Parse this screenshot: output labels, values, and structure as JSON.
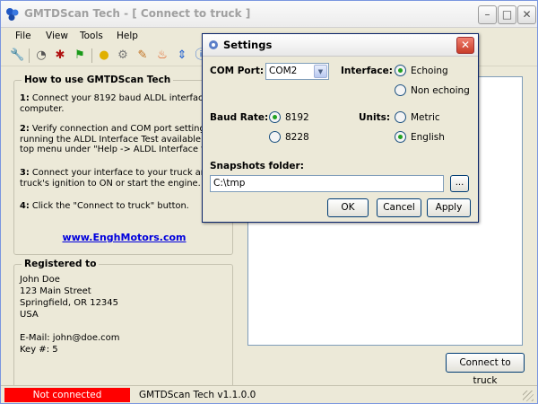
{
  "window": {
    "title": "GMTDScan Tech - [ Connect to truck ]",
    "buttons": {
      "minimize_icon": "minimize-icon",
      "maximize_icon": "maximize-icon",
      "close_icon": "close-icon"
    }
  },
  "menu": [
    "File",
    "View",
    "Tools",
    "Help"
  ],
  "toolbar": {
    "icons": [
      "wrench-icon",
      "gauge-icon",
      "bug-icon",
      "flag-icon",
      "lightbulb-icon",
      "settings-icon",
      "pencil-icon",
      "flame-icon",
      "arrows-icon",
      "info-icon"
    ]
  },
  "howto": {
    "title": "How to use GMTDScan Tech",
    "steps": [
      {
        "num": "1:",
        "text": " Connect your 8192 baud ALDL interface to\ncomputer."
      },
      {
        "num": "2:",
        "text": " Verify connection and COM port settings by\nrunning the ALDL Interface Test available from\ntop menu under \"Help -> ALDL Interface test\"."
      },
      {
        "num": "3:",
        "text": " Connect your interface to your truck and tu\ntruck's ignition to ON or start the engine."
      },
      {
        "num": "4:",
        "text": " Click the \"Connect to truck\" button."
      }
    ],
    "link": "www.EnghMotors.com"
  },
  "registered": {
    "title": "Registered to",
    "lines": [
      "John Doe",
      "123 Main Street",
      "Springfield, OR 12345",
      "USA",
      "",
      "E-Mail: john@doe.com",
      "Key #: 5"
    ]
  },
  "connect_button": "Connect to truck",
  "status": {
    "connection": "Not connected",
    "version": "GMTDScan Tech v1.1.0.0",
    "connection_color": "#ff0000"
  },
  "settings": {
    "title": "Settings",
    "com_port_label": "COM Port:",
    "com_port_value": "COM2",
    "interface_label": "Interface:",
    "interface_options": [
      {
        "label": "Echoing",
        "selected": true
      },
      {
        "label": "Non echoing",
        "selected": false
      }
    ],
    "baud_rate_label": "Baud Rate:",
    "baud_options": [
      {
        "label": "8192",
        "selected": true
      },
      {
        "label": "8228",
        "selected": false
      }
    ],
    "units_label": "Units:",
    "units_options": [
      {
        "label": "Metric",
        "selected": false
      },
      {
        "label": "English",
        "selected": true
      }
    ],
    "snapshots_label": "Snapshots folder:",
    "snapshots_value": "C:\\tmp",
    "browse_label": "...",
    "ok_label": "OK",
    "cancel_label": "Cancel",
    "apply_label": "Apply"
  }
}
